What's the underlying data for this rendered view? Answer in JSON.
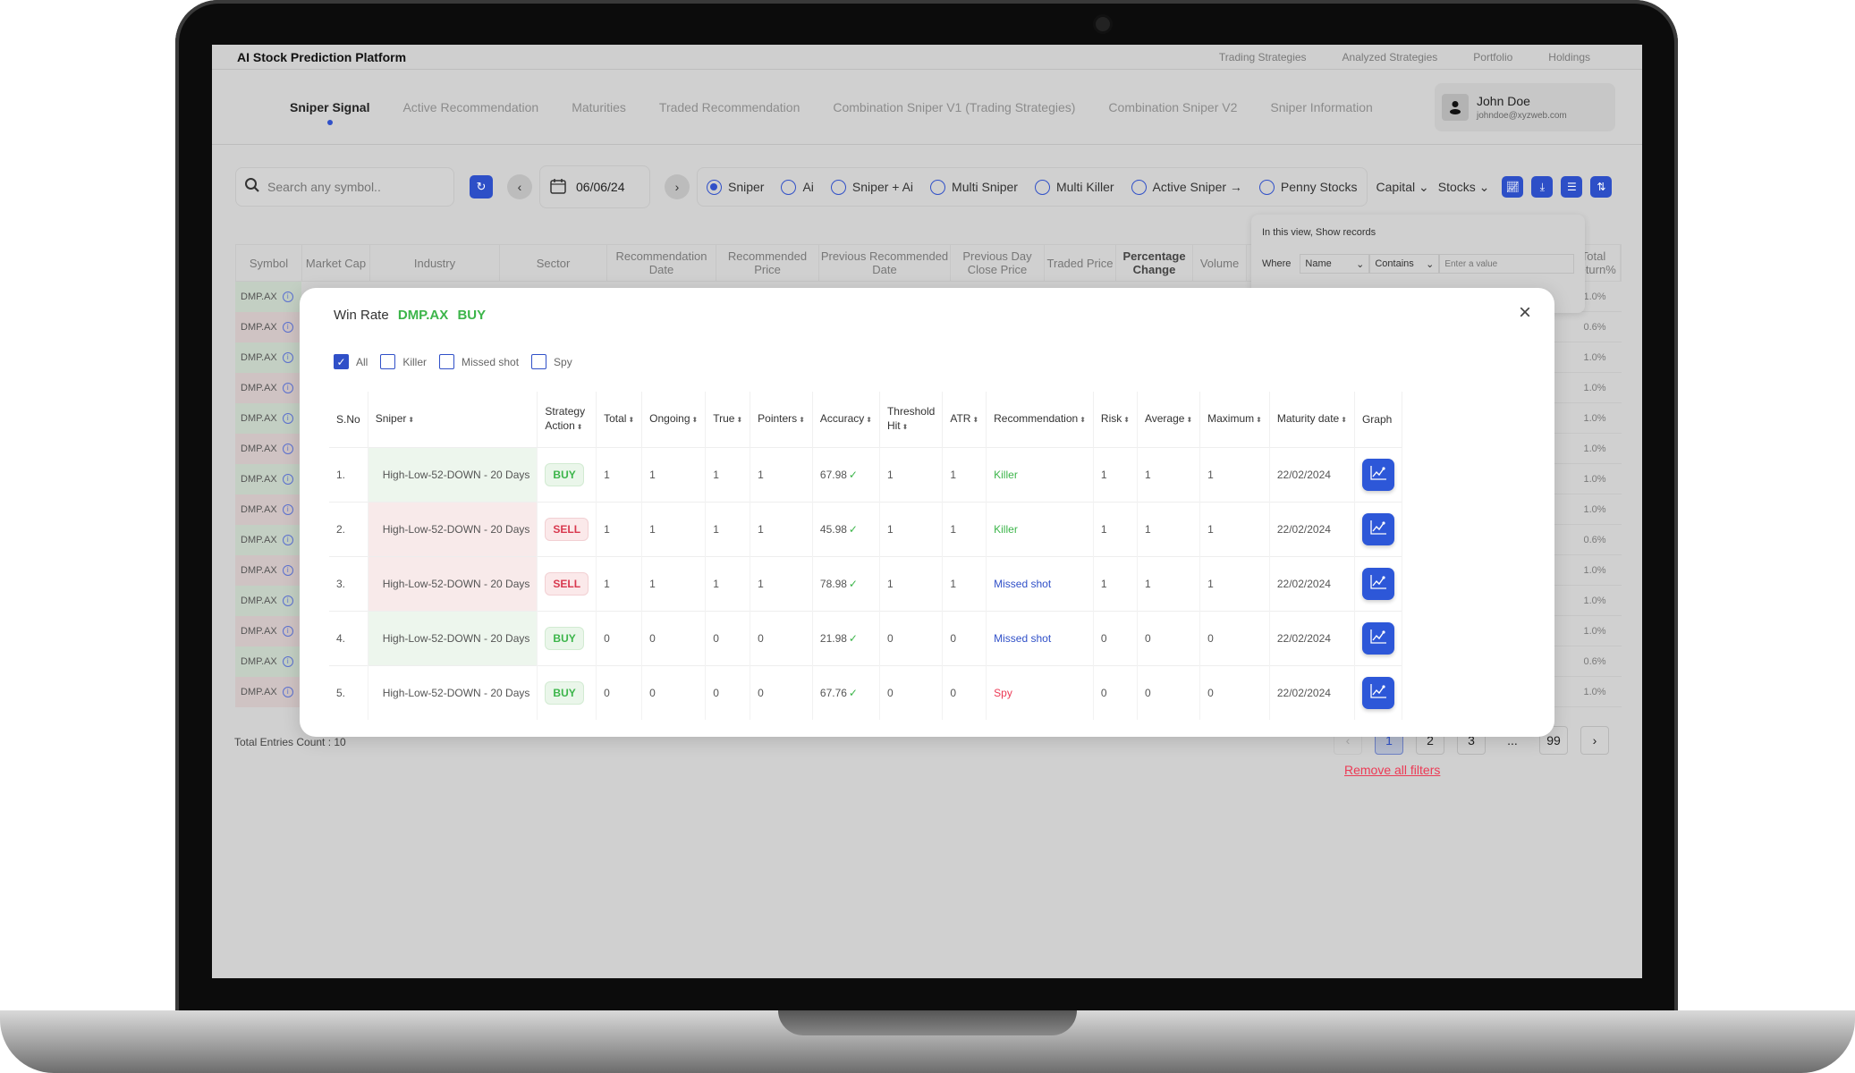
{
  "app": {
    "title": "AI Stock Prediction Platform"
  },
  "top_links": [
    "Trading Strategies",
    "Analyzed Strategies",
    "Portfolio",
    "Holdings"
  ],
  "nav_tabs": [
    {
      "label": "Sniper Signal",
      "active": true
    },
    {
      "label": "Active Recommendation"
    },
    {
      "label": "Maturities"
    },
    {
      "label": "Traded Recommendation"
    },
    {
      "label": "Combination Sniper V1 (Trading Strategies)"
    },
    {
      "label": "Combination Sniper V2"
    },
    {
      "label": "Sniper Information"
    }
  ],
  "user": {
    "name": "John Doe",
    "email": "johndoe@xyzweb.com",
    "icon": "user-icon"
  },
  "toolbar": {
    "search_placeholder": "Search any symbol..",
    "date": "06/06/24",
    "radios": [
      {
        "label": "Sniper",
        "selected": true
      },
      {
        "label": "Ai"
      },
      {
        "label": "Sniper + Ai"
      },
      {
        "label": "Multi Sniper"
      },
      {
        "label": "Multi Killer"
      },
      {
        "label": "Active Sniper →"
      },
      {
        "label": "Penny Stocks"
      }
    ],
    "capital_label": "Capital",
    "stocks_label": "Stocks",
    "icons": [
      "chart-icon",
      "download-icon",
      "filter-icon",
      "sort-icon"
    ]
  },
  "filter_popup": {
    "title": "In this view, Show records",
    "where_label": "Where",
    "field": "Name",
    "operator": "Contains",
    "value_placeholder": "Enter a value"
  },
  "bg_table": {
    "headers": [
      "Symbol",
      "Market Cap",
      "Industry",
      "Sector",
      "Recommendation Date",
      "Recommended Price",
      "Previous Recommended Date",
      "Previous Day Close Price",
      "Traded Price",
      "Percentage Change",
      "Volume",
      "Total Return%"
    ],
    "symbols": [
      "DMP.AX",
      "DMP.AX",
      "DMP.AX",
      "DMP.AX",
      "DMP.AX",
      "DMP.AX",
      "DMP.AX",
      "DMP.AX",
      "DMP.AX",
      "DMP.AX",
      "DMP.AX",
      "DMP.AX",
      "DMP.AX",
      "DMP.AX"
    ],
    "returns": [
      "1.0%",
      "0.6%",
      "1.0%",
      "1.0%",
      "1.0%",
      "1.0%",
      "1.0%",
      "1.0%",
      "0.6%",
      "1.0%",
      "1.0%",
      "1.0%",
      "0.6%",
      "1.0%"
    ]
  },
  "footer": {
    "total_entries": "Total Entries Count : 10",
    "pages": [
      "1",
      "2",
      "3",
      "...",
      "99"
    ],
    "current_page": "1",
    "remove_filters": "Remove all filters"
  },
  "modal": {
    "title": "Win Rate",
    "symbol": "DMP.AX",
    "action": "BUY",
    "filters": [
      {
        "label": "All",
        "checked": true
      },
      {
        "label": "Killer",
        "checked": false
      },
      {
        "label": "Missed shot",
        "checked": false
      },
      {
        "label": "Spy",
        "checked": false
      }
    ],
    "headers": [
      "S.No",
      "Sniper",
      "Strategy Action",
      "Total",
      "Ongoing",
      "True",
      "Pointers",
      "Accuracy",
      "Threshold Hit",
      "ATR",
      "Recommendation",
      "Risk",
      "Average",
      "Maximum",
      "Maturity date",
      "Graph"
    ],
    "rows": [
      {
        "sno": "1.",
        "sniper": "High-Low-52-DOWN - 20 Days",
        "action": "BUY",
        "total": "1",
        "ongoing": "1",
        "true": "1",
        "pointers": "1",
        "accuracy": "67.98",
        "threshold": "1",
        "atr": "1",
        "rec": "Killer",
        "risk": "1",
        "average": "1",
        "maximum": "1",
        "maturity": "22/02/2024"
      },
      {
        "sno": "2.",
        "sniper": "High-Low-52-DOWN - 20 Days",
        "action": "SELL",
        "total": "1",
        "ongoing": "1",
        "true": "1",
        "pointers": "1",
        "accuracy": "45.98",
        "threshold": "1",
        "atr": "1",
        "rec": "Killer",
        "risk": "1",
        "average": "1",
        "maximum": "1",
        "maturity": "22/02/2024"
      },
      {
        "sno": "3.",
        "sniper": "High-Low-52-DOWN - 20 Days",
        "action": "SELL",
        "total": "1",
        "ongoing": "1",
        "true": "1",
        "pointers": "1",
        "accuracy": "78.98",
        "threshold": "1",
        "atr": "1",
        "rec": "Missed shot",
        "risk": "1",
        "average": "1",
        "maximum": "1",
        "maturity": "22/02/2024"
      },
      {
        "sno": "4.",
        "sniper": "High-Low-52-DOWN - 20 Days",
        "action": "BUY",
        "total": "0",
        "ongoing": "0",
        "true": "0",
        "pointers": "0",
        "accuracy": "21.98",
        "threshold": "0",
        "atr": "0",
        "rec": "Missed shot",
        "risk": "0",
        "average": "0",
        "maximum": "0",
        "maturity": "22/02/2024"
      },
      {
        "sno": "5.",
        "sniper": "High-Low-52-DOWN - 20 Days",
        "action": "BUY",
        "total": "0",
        "ongoing": "0",
        "true": "0",
        "pointers": "0",
        "accuracy": "67.76",
        "threshold": "0",
        "atr": "0",
        "rec": "Spy",
        "risk": "0",
        "average": "0",
        "maximum": "0",
        "maturity": "22/02/2024"
      }
    ]
  },
  "colors": {
    "accent": "#2d4fc7",
    "buy": "#3cb54a",
    "sell": "#d8384e",
    "missed": "#3050c8",
    "spy": "#ec3a55"
  }
}
